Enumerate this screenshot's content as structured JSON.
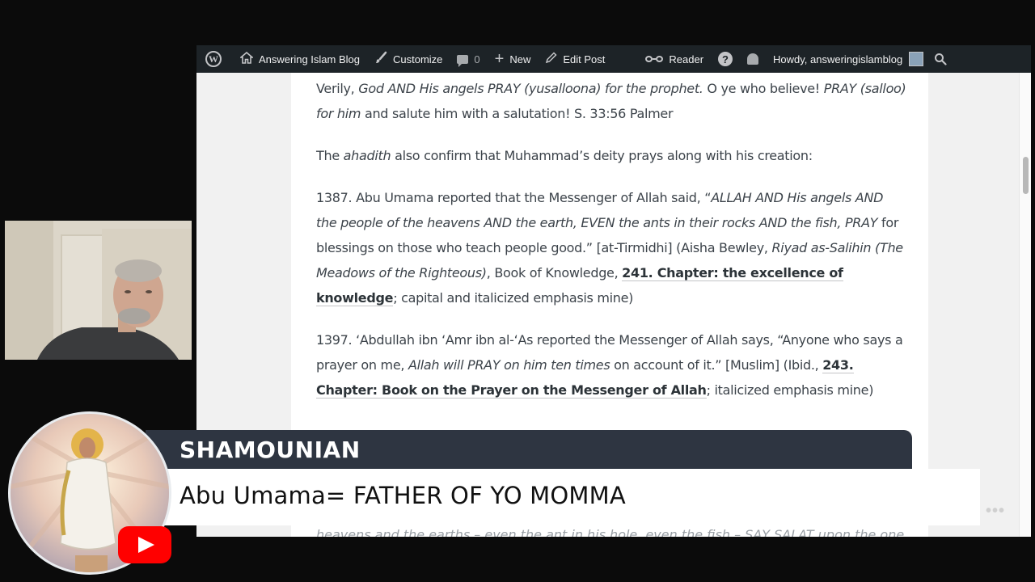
{
  "admin_bar": {
    "site_name": "Answering Islam Blog",
    "customize": "Customize",
    "comments_count": "0",
    "new_label": "New",
    "edit_post": "Edit Post",
    "reader": "Reader",
    "howdy": "Howdy, answeringislamblog"
  },
  "article": {
    "p1": {
      "a": "Verily, ",
      "b": "God AND His angels PRAY (yusalloona) for the prophet.",
      "c": " O ye who believe! ",
      "d": "PRAY (salloo) for him",
      "e": " and salute him with a salutation! S. 33:56 Palmer"
    },
    "p2": {
      "a": "The ",
      "b": "ahadith",
      "c": " also confirm that Muhammad’s deity prays along with his creation:"
    },
    "p3": {
      "a": "1387. Abu Umama reported that the Messenger of Allah said, “",
      "b": "ALLAH AND His angels AND the people of the heavens AND the earth, EVEN the ants in their rocks AND the fish, PRAY",
      "c": " for blessings on those who teach people good.” [at-Tirmidhi] (Aisha Bewley, ",
      "d": "Riyad as-Salihin (The Meadows of the Righteous)",
      "e": ", Book of Knowledge, ",
      "f": "241. Chapter: the excellence of knowledge",
      "g": "; capital and italicized emphasis mine)"
    },
    "p4": {
      "a": "1397. ‘Abdullah ibn ‘Amr ibn al-‘As reported the Messenger of Allah says, “Anyone who says a prayer on me, ",
      "b": "Allah will PRAY on him ten times",
      "c": " on account of it.” [Muslim] (Ibid., ",
      "d": "243. Chapter: Book on the Prayer on the Messenger of Allah",
      "e": "; italicized emphasis mine)"
    },
    "faded_line": "heavens and the earths – even the ant in his hole, even the fish – SAY SALAT upon the one"
  },
  "overlay": {
    "name": "SHAMOUNIAN",
    "message": "Abu Umama= FATHER OF YO MOMMA",
    "more": "•••"
  },
  "icons": {
    "wp": "wordpress-logo-icon",
    "home": "home-icon",
    "brush": "brush-icon",
    "comment": "comment-icon",
    "plus": "plus-icon",
    "pencil": "pencil-icon",
    "reader": "glasses-icon",
    "help": "help-icon",
    "bell": "bell-icon",
    "search": "search-icon",
    "youtube": "youtube-logo-icon"
  },
  "colors": {
    "admin_bar": "#1d2327",
    "name_bar": "#2e3541",
    "youtube_red": "#ff0000"
  }
}
